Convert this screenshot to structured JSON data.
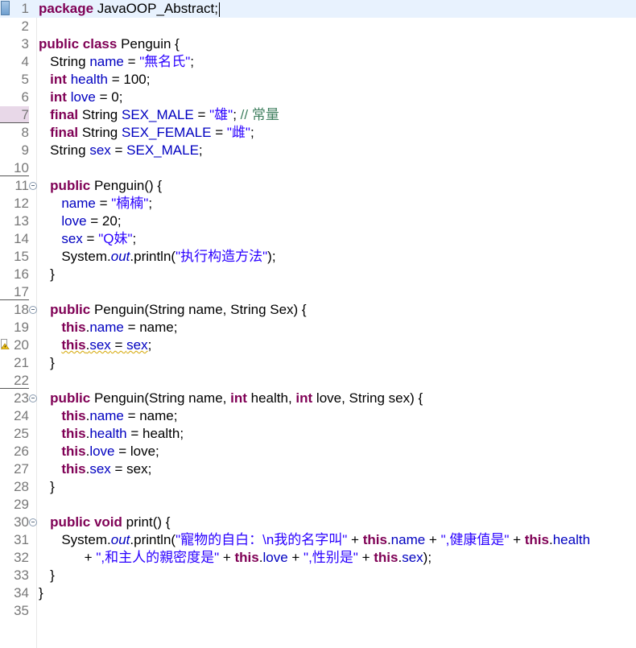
{
  "editor": {
    "lines": [
      {
        "n": "1",
        "tokens": [
          {
            "t": "package",
            "c": "k"
          },
          {
            "t": " JavaOOP_Abstract;",
            "c": "p"
          }
        ],
        "current": true,
        "annot": true,
        "caret": true
      },
      {
        "n": "2",
        "tokens": []
      },
      {
        "n": "3",
        "tokens": [
          {
            "t": "public",
            "c": "k"
          },
          {
            "t": " ",
            "c": "p"
          },
          {
            "t": "class",
            "c": "k"
          },
          {
            "t": " Penguin {",
            "c": "p"
          }
        ]
      },
      {
        "n": "4",
        "tokens": [
          {
            "t": "   String ",
            "c": "p"
          },
          {
            "t": "name",
            "c": "f"
          },
          {
            "t": " = ",
            "c": "p"
          },
          {
            "t": "\"無名氏\"",
            "c": "s"
          },
          {
            "t": ";",
            "c": "p"
          }
        ]
      },
      {
        "n": "5",
        "tokens": [
          {
            "t": "   ",
            "c": "p"
          },
          {
            "t": "int",
            "c": "k"
          },
          {
            "t": " ",
            "c": "p"
          },
          {
            "t": "health",
            "c": "f"
          },
          {
            "t": " = 100;",
            "c": "p"
          }
        ]
      },
      {
        "n": "6",
        "tokens": [
          {
            "t": "   ",
            "c": "p"
          },
          {
            "t": "int",
            "c": "k"
          },
          {
            "t": " ",
            "c": "p"
          },
          {
            "t": "love",
            "c": "f"
          },
          {
            "t": " = 0;",
            "c": "p"
          }
        ]
      },
      {
        "n": "7",
        "tokens": [
          {
            "t": "   ",
            "c": "p"
          },
          {
            "t": "final",
            "c": "k"
          },
          {
            "t": " String ",
            "c": "p"
          },
          {
            "t": "SEX_MALE",
            "c": "f"
          },
          {
            "t": " = ",
            "c": "p"
          },
          {
            "t": "\"雄\"",
            "c": "s"
          },
          {
            "t": "; ",
            "c": "p"
          },
          {
            "t": "// 常量",
            "c": "c"
          }
        ],
        "mark": true,
        "bkmk": true
      },
      {
        "n": "8",
        "tokens": [
          {
            "t": "   ",
            "c": "p"
          },
          {
            "t": "final",
            "c": "k"
          },
          {
            "t": " String ",
            "c": "p"
          },
          {
            "t": "SEX_FEMALE",
            "c": "f"
          },
          {
            "t": " = ",
            "c": "p"
          },
          {
            "t": "\"雌\"",
            "c": "s"
          },
          {
            "t": ";",
            "c": "p"
          }
        ]
      },
      {
        "n": "9",
        "tokens": [
          {
            "t": "   String ",
            "c": "p"
          },
          {
            "t": "sex",
            "c": "f"
          },
          {
            "t": " = ",
            "c": "p"
          },
          {
            "t": "SEX_MALE",
            "c": "f"
          },
          {
            "t": ";",
            "c": "p"
          }
        ]
      },
      {
        "n": "10",
        "tokens": [],
        "mark": true
      },
      {
        "n": "11",
        "tokens": [
          {
            "t": "   ",
            "c": "p"
          },
          {
            "t": "public",
            "c": "k"
          },
          {
            "t": " Penguin() {",
            "c": "p"
          }
        ],
        "fold": true
      },
      {
        "n": "12",
        "tokens": [
          {
            "t": "      ",
            "c": "p"
          },
          {
            "t": "name",
            "c": "f"
          },
          {
            "t": " = ",
            "c": "p"
          },
          {
            "t": "\"楠楠\"",
            "c": "s"
          },
          {
            "t": ";",
            "c": "p"
          }
        ]
      },
      {
        "n": "13",
        "tokens": [
          {
            "t": "      ",
            "c": "p"
          },
          {
            "t": "love",
            "c": "f"
          },
          {
            "t": " = 20;",
            "c": "p"
          }
        ]
      },
      {
        "n": "14",
        "tokens": [
          {
            "t": "      ",
            "c": "p"
          },
          {
            "t": "sex",
            "c": "f"
          },
          {
            "t": " = ",
            "c": "p"
          },
          {
            "t": "\"Q妹\"",
            "c": "s"
          },
          {
            "t": ";",
            "c": "p"
          }
        ]
      },
      {
        "n": "15",
        "tokens": [
          {
            "t": "      System.",
            "c": "p"
          },
          {
            "t": "out",
            "c": "st"
          },
          {
            "t": ".println(",
            "c": "p"
          },
          {
            "t": "\"执行构造方法\"",
            "c": "s"
          },
          {
            "t": ");",
            "c": "p"
          }
        ]
      },
      {
        "n": "16",
        "tokens": [
          {
            "t": "   }",
            "c": "p"
          }
        ]
      },
      {
        "n": "17",
        "tokens": [],
        "mark": true
      },
      {
        "n": "18",
        "tokens": [
          {
            "t": "   ",
            "c": "p"
          },
          {
            "t": "public",
            "c": "k"
          },
          {
            "t": " Penguin(String name, String Sex) {",
            "c": "p"
          }
        ],
        "fold": true
      },
      {
        "n": "19",
        "tokens": [
          {
            "t": "      ",
            "c": "p"
          },
          {
            "t": "this",
            "c": "k"
          },
          {
            "t": ".",
            "c": "p"
          },
          {
            "t": "name",
            "c": "f"
          },
          {
            "t": " = name;",
            "c": "p"
          }
        ]
      },
      {
        "n": "20",
        "tokens": [
          {
            "t": "      ",
            "c": "p"
          },
          {
            "t": "this",
            "c": "k",
            "w": true
          },
          {
            "t": ".",
            "c": "p",
            "w": true
          },
          {
            "t": "sex",
            "c": "f",
            "w": true
          },
          {
            "t": " = ",
            "c": "p",
            "w": true
          },
          {
            "t": "sex",
            "c": "f",
            "w": true
          },
          {
            "t": ";",
            "c": "p"
          }
        ],
        "warn": true
      },
      {
        "n": "21",
        "tokens": [
          {
            "t": "   }",
            "c": "p"
          }
        ]
      },
      {
        "n": "22",
        "tokens": [],
        "mark": true
      },
      {
        "n": "23",
        "tokens": [
          {
            "t": "   ",
            "c": "p"
          },
          {
            "t": "public",
            "c": "k"
          },
          {
            "t": " Penguin(String name, ",
            "c": "p"
          },
          {
            "t": "int",
            "c": "k"
          },
          {
            "t": " health, ",
            "c": "p"
          },
          {
            "t": "int",
            "c": "k"
          },
          {
            "t": " love, String sex) {",
            "c": "p"
          }
        ],
        "fold": true
      },
      {
        "n": "24",
        "tokens": [
          {
            "t": "      ",
            "c": "p"
          },
          {
            "t": "this",
            "c": "k"
          },
          {
            "t": ".",
            "c": "p"
          },
          {
            "t": "name",
            "c": "f"
          },
          {
            "t": " = name;",
            "c": "p"
          }
        ]
      },
      {
        "n": "25",
        "tokens": [
          {
            "t": "      ",
            "c": "p"
          },
          {
            "t": "this",
            "c": "k"
          },
          {
            "t": ".",
            "c": "p"
          },
          {
            "t": "health",
            "c": "f"
          },
          {
            "t": " = health;",
            "c": "p"
          }
        ]
      },
      {
        "n": "26",
        "tokens": [
          {
            "t": "      ",
            "c": "p"
          },
          {
            "t": "this",
            "c": "k"
          },
          {
            "t": ".",
            "c": "p"
          },
          {
            "t": "love",
            "c": "f"
          },
          {
            "t": " = love;",
            "c": "p"
          }
        ]
      },
      {
        "n": "27",
        "tokens": [
          {
            "t": "      ",
            "c": "p"
          },
          {
            "t": "this",
            "c": "k"
          },
          {
            "t": ".",
            "c": "p"
          },
          {
            "t": "sex",
            "c": "f"
          },
          {
            "t": " = sex;",
            "c": "p"
          }
        ]
      },
      {
        "n": "28",
        "tokens": [
          {
            "t": "   }",
            "c": "p"
          }
        ]
      },
      {
        "n": "29",
        "tokens": []
      },
      {
        "n": "30",
        "tokens": [
          {
            "t": "   ",
            "c": "p"
          },
          {
            "t": "public",
            "c": "k"
          },
          {
            "t": " ",
            "c": "p"
          },
          {
            "t": "void",
            "c": "k"
          },
          {
            "t": " print() {",
            "c": "p"
          }
        ],
        "fold": true
      },
      {
        "n": "31",
        "tokens": [
          {
            "t": "      System.",
            "c": "p"
          },
          {
            "t": "out",
            "c": "st"
          },
          {
            "t": ".println(",
            "c": "p"
          },
          {
            "t": "\"寵物的自白：\\n我的名字叫\"",
            "c": "s"
          },
          {
            "t": " + ",
            "c": "p"
          },
          {
            "t": "this",
            "c": "k"
          },
          {
            "t": ".",
            "c": "p"
          },
          {
            "t": "name",
            "c": "f"
          },
          {
            "t": " + ",
            "c": "p"
          },
          {
            "t": "\",健康值是\"",
            "c": "s"
          },
          {
            "t": " + ",
            "c": "p"
          },
          {
            "t": "this",
            "c": "k"
          },
          {
            "t": ".",
            "c": "p"
          },
          {
            "t": "health",
            "c": "f"
          }
        ]
      },
      {
        "n": "32",
        "tokens": [
          {
            "t": "            + ",
            "c": "p"
          },
          {
            "t": "\",和主人的親密度是\"",
            "c": "s"
          },
          {
            "t": " + ",
            "c": "p"
          },
          {
            "t": "this",
            "c": "k"
          },
          {
            "t": ".",
            "c": "p"
          },
          {
            "t": "love",
            "c": "f"
          },
          {
            "t": " + ",
            "c": "p"
          },
          {
            "t": "\",性别是\"",
            "c": "s"
          },
          {
            "t": " + ",
            "c": "p"
          },
          {
            "t": "this",
            "c": "k"
          },
          {
            "t": ".",
            "c": "p"
          },
          {
            "t": "sex",
            "c": "f"
          },
          {
            "t": ");",
            "c": "p"
          }
        ]
      },
      {
        "n": "33",
        "tokens": [
          {
            "t": "   }",
            "c": "p"
          }
        ]
      },
      {
        "n": "34",
        "tokens": [
          {
            "t": "}",
            "c": "p"
          }
        ]
      },
      {
        "n": "35",
        "tokens": []
      }
    ]
  },
  "icons": {
    "fold": "collapse-icon",
    "warning": "warning-icon",
    "annotation": "annotation-marker-icon"
  },
  "colors": {
    "keyword": "#7f0055",
    "field": "#0000c0",
    "string": "#2a00ff",
    "comment": "#3f7f5f",
    "current_line": "#e8f2fe"
  }
}
